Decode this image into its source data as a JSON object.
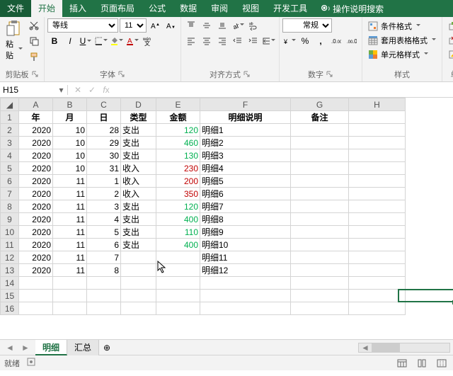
{
  "tabs": {
    "file": "文件",
    "home": "开始",
    "insert": "插入",
    "layout": "页面布局",
    "formulas": "公式",
    "data": "数据",
    "review": "审阅",
    "view": "视图",
    "dev": "开发工具",
    "tellme": "操作说明搜索"
  },
  "ribbon": {
    "clipboard": {
      "paste": "粘贴",
      "label": "剪贴板"
    },
    "font": {
      "name": "等线",
      "size": "11",
      "label": "字体"
    },
    "align": {
      "label": "对齐方式"
    },
    "number": {
      "format": "常规",
      "label": "数字"
    },
    "styles": {
      "cond": "条件格式",
      "tablefmt": "套用表格格式",
      "cell": "单元格样式",
      "label": "样式"
    },
    "cells": {
      "insert": "插",
      "delete": "删",
      "format": "格",
      "label": "单元"
    }
  },
  "namebox": "H15",
  "columns": [
    "A",
    "B",
    "C",
    "D",
    "E",
    "F",
    "G",
    "H"
  ],
  "header": {
    "A": "年",
    "B": "月",
    "C": "日",
    "D": "类型",
    "E": "金额",
    "F": "明细说明",
    "G": "备注"
  },
  "chart_data": {
    "type": "table",
    "columns": [
      "年",
      "月",
      "日",
      "类型",
      "金额",
      "明细说明",
      "备注"
    ],
    "rows": [
      {
        "年": 2020,
        "月": 10,
        "日": 28,
        "类型": "支出",
        "金额": 120,
        "明细说明": "明细1",
        "备注": ""
      },
      {
        "年": 2020,
        "月": 10,
        "日": 29,
        "类型": "支出",
        "金额": 460,
        "明细说明": "明细2",
        "备注": ""
      },
      {
        "年": 2020,
        "月": 10,
        "日": 30,
        "类型": "支出",
        "金额": 130,
        "明细说明": "明细3",
        "备注": ""
      },
      {
        "年": 2020,
        "月": 10,
        "日": 31,
        "类型": "收入",
        "金额": 230,
        "明细说明": "明细4",
        "备注": ""
      },
      {
        "年": 2020,
        "月": 11,
        "日": 1,
        "类型": "收入",
        "金额": 200,
        "明细说明": "明细5",
        "备注": ""
      },
      {
        "年": 2020,
        "月": 11,
        "日": 2,
        "类型": "收入",
        "金额": 350,
        "明细说明": "明细6",
        "备注": ""
      },
      {
        "年": 2020,
        "月": 11,
        "日": 3,
        "类型": "支出",
        "金额": 120,
        "明细说明": "明细7",
        "备注": ""
      },
      {
        "年": 2020,
        "月": 11,
        "日": 4,
        "类型": "支出",
        "金额": 400,
        "明细说明": "明细8",
        "备注": ""
      },
      {
        "年": 2020,
        "月": 11,
        "日": 5,
        "类型": "支出",
        "金额": 110,
        "明细说明": "明细9",
        "备注": ""
      },
      {
        "年": 2020,
        "月": 11,
        "日": 6,
        "类型": "支出",
        "金额": 400,
        "明细说明": "明细10",
        "备注": ""
      },
      {
        "年": 2020,
        "月": 11,
        "日": 7,
        "类型": "",
        "金额": "",
        "明细说明": "明细11",
        "备注": ""
      },
      {
        "年": 2020,
        "月": 11,
        "日": 8,
        "类型": "",
        "金额": "",
        "明细说明": "明细12",
        "备注": ""
      }
    ]
  },
  "sheets": {
    "active": "明细",
    "other": "汇总"
  },
  "status": {
    "ready": "就绪"
  }
}
